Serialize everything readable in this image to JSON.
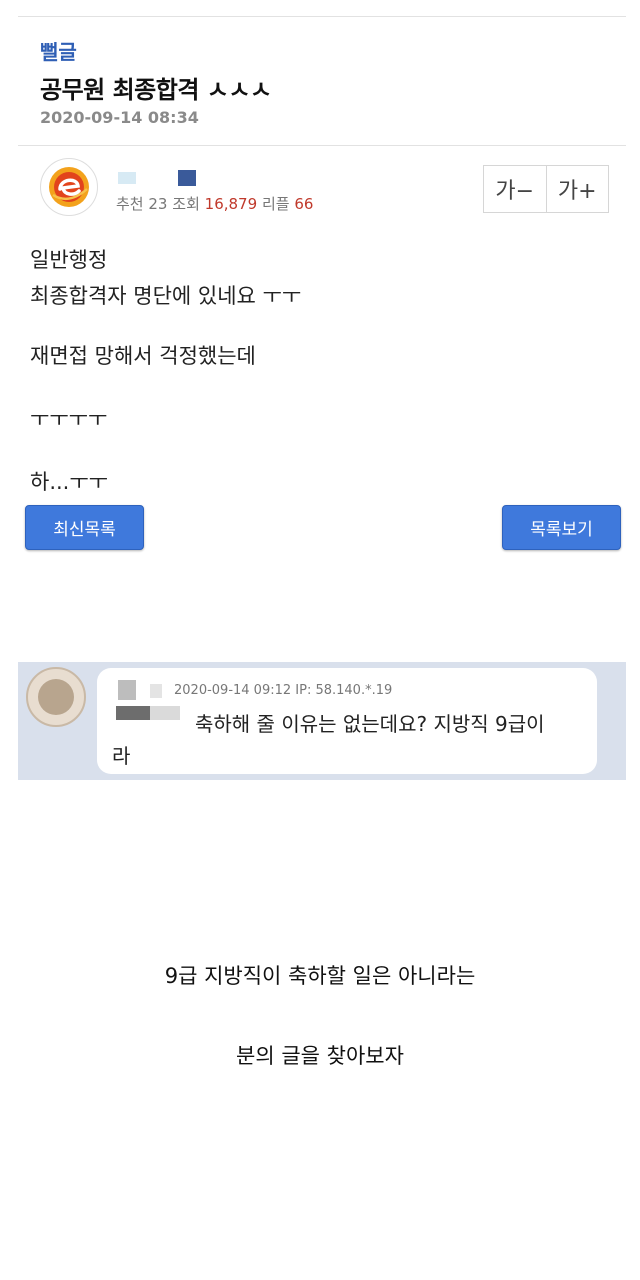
{
  "post": {
    "category": "뻘글",
    "title": "공무원 최종합격 ㅅㅅㅅ",
    "date": "2020-09-14 08:34",
    "stats": {
      "recommend_label": "추천",
      "recommend": "23",
      "views_label": "조회",
      "views": "16,879",
      "replies_label": "리플",
      "replies": "66"
    },
    "font_buttons": {
      "smaller": "가−",
      "larger": "가+"
    },
    "body": [
      "일반행정",
      "최종합격자 명단에 있네요 ㅜㅜ",
      "재면접 망해서 걱정했는데",
      "ㅜㅜㅜㅜ",
      "하...ㅜㅜ"
    ],
    "buttons": {
      "latest": "최신목록",
      "list": "목록보기"
    }
  },
  "comment": {
    "meta": "2020-09-14 09:12  IP: 58.140.*.19",
    "text_line1": "축하해 줄 이유는 없는데요? 지방직 9급이",
    "text_line2": "라"
  },
  "caption": {
    "line1": "9급 지방직이 축하할 일은 아니라는",
    "line2": "분의 글을 찾아보자"
  },
  "colors": {
    "category": "#2f5fb5",
    "button": "#3f79dc",
    "count": "#c0392b",
    "comment_bg": "#d9e0ec"
  }
}
